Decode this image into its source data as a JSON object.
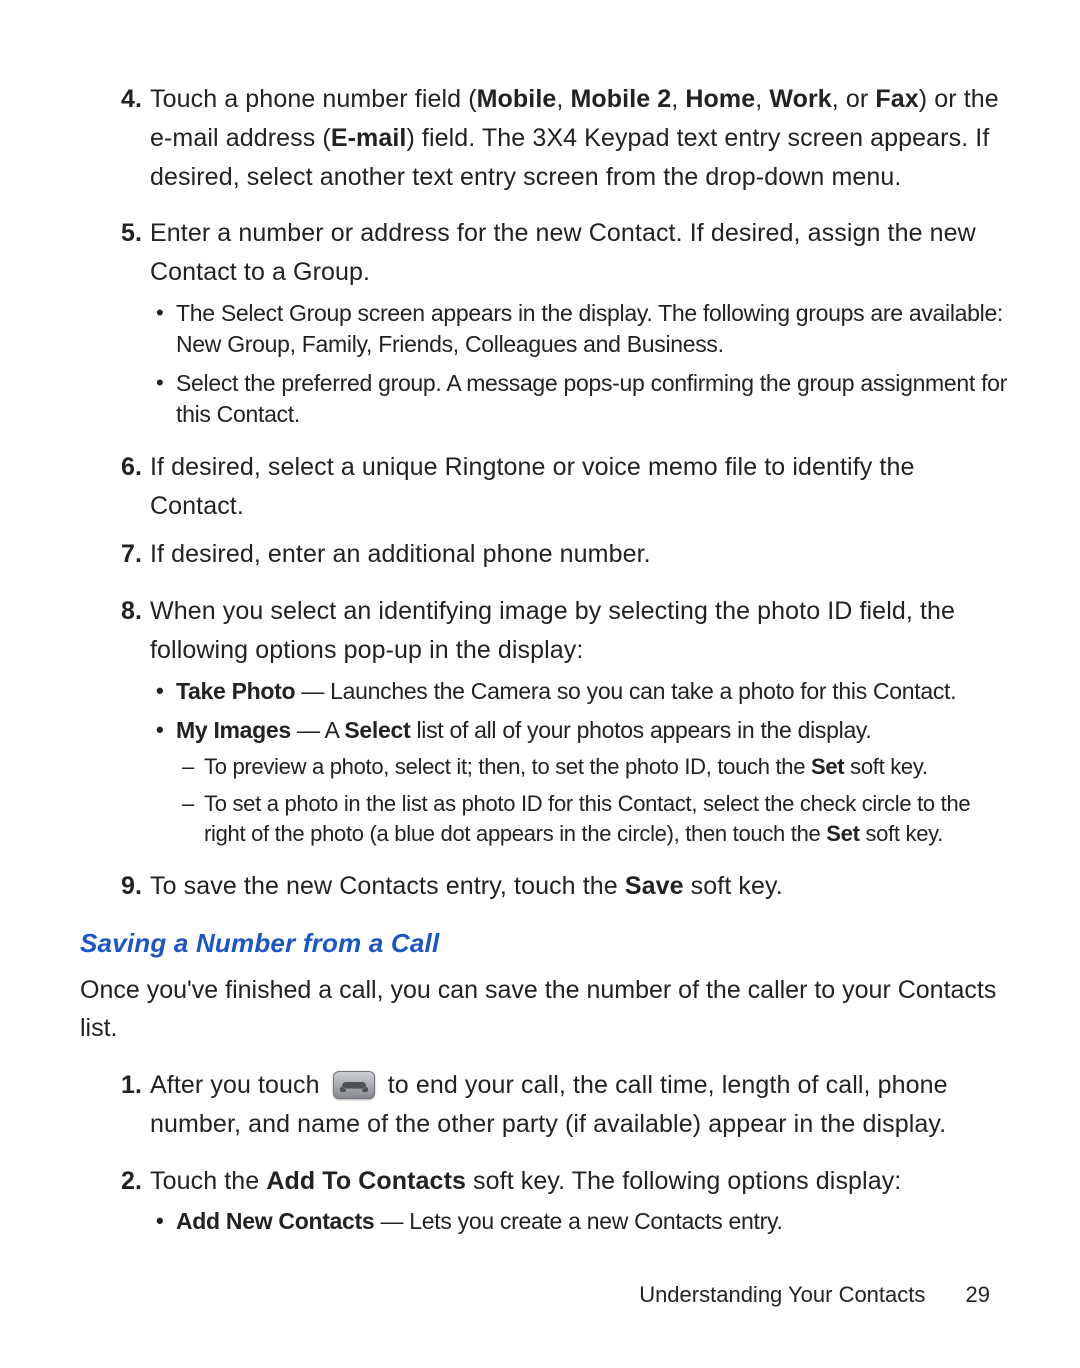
{
  "list1": {
    "items": [
      {
        "num": "4.",
        "pre": "Touch a phone number field (",
        "b1": "Mobile",
        "c1": ", ",
        "b2": "Mobile 2",
        "c2": ", ",
        "b3": "Home",
        "c3": ", ",
        "b4": "Work",
        "c4": ", or ",
        "b5": "Fax",
        "post1": ") or the e-mail address (",
        "b6": "E-mail",
        "post2": ") field. The 3X4 Keypad text entry screen appears. If desired, select another text entry screen from the drop-down menu."
      },
      {
        "num": "5.",
        "text": "Enter a number or address for the new Contact. If desired, assign the new Contact to a Group.",
        "sub": [
          "The Select Group screen appears in the display. The following groups are available: New Group, Family, Friends, Colleagues and Business.",
          "Select the preferred group. A message pops-up confirming the group assignment for this Contact."
        ]
      },
      {
        "num": "6.",
        "text": "If desired, select a unique Ringtone or voice memo file to identify the Contact."
      },
      {
        "num": "7.",
        "text": "If desired, enter an additional phone number."
      },
      {
        "num": "8.",
        "text": "When you select an identifying image by selecting the photo ID field, the following options pop-up in the display:",
        "sub2": [
          {
            "lead": "Take Photo",
            "sep": " — ",
            "rest": "Launches the Camera so you can take a photo for this Contact."
          },
          {
            "lead": "My Images",
            "sep": " — A ",
            "bold2": "Select",
            "rest": " list of all of your photos appears in the display.",
            "dash": [
              {
                "pre": "To preview a photo, select it; then, to set the photo ID, touch the ",
                "b": "Set",
                "post": " soft key."
              },
              {
                "pre": "To set a photo in the list as photo ID for this Contact, select the check circle to the right of the photo (a blue dot appears in the circle), then touch the ",
                "b": "Set",
                "post": " soft key."
              }
            ]
          }
        ]
      },
      {
        "num": "9.",
        "pre": "To save the new Contacts entry, touch the ",
        "b1": "Save",
        "post1": " soft key."
      }
    ]
  },
  "section": {
    "title": "Saving a Number from a Call",
    "intro": "Once you've finished a call, you can save the number of the caller to your Contacts list."
  },
  "list2": {
    "items": [
      {
        "num": "1.",
        "pre": "After you touch ",
        "icon": "end-call-icon",
        "post": " to end your call, the call time, length of call, phone number, and name of the other party (if available) appear in the display."
      },
      {
        "num": "2.",
        "pre": "Touch the ",
        "b1": "Add To Contacts",
        "post1": " soft key. The following options display:",
        "sub": [
          {
            "lead": "Add New Contacts",
            "sep": " — ",
            "rest": "Lets you create a new Contacts entry."
          }
        ]
      }
    ]
  },
  "footer": {
    "section": "Understanding Your Contacts",
    "page": "29"
  }
}
